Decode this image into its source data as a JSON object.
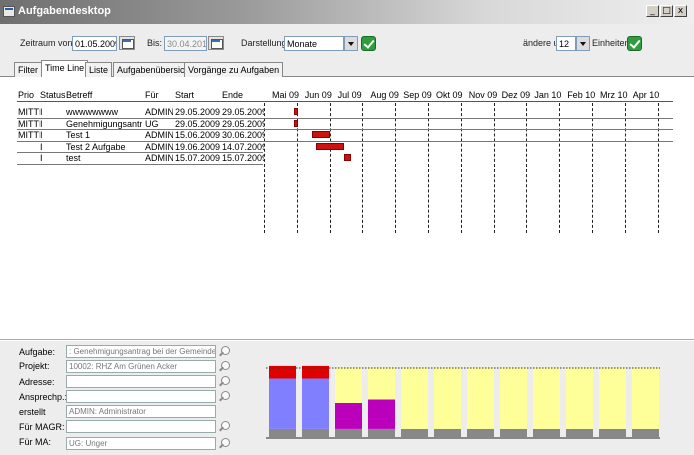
{
  "window": {
    "title": "Aufgabendesktop",
    "minimize": "_",
    "maximize": "□",
    "close": "x"
  },
  "toolbar": {
    "zeitraum_label": "Zeitraum von:",
    "von_value": "01.05.2009",
    "bis_label": "Bis:",
    "bis_value": "30.04.2010",
    "darstellung_label": "Darstellung",
    "darstellung_value": "Monate",
    "aendere_label": "ändere um",
    "aendere_value": "12",
    "einheiten_label": "Einheiten"
  },
  "tabs": [
    {
      "label": "Filter"
    },
    {
      "label": "Time Line"
    },
    {
      "label": "Liste"
    },
    {
      "label": "Aufgabenübersicht"
    },
    {
      "label": "Vorgänge zu Aufgaben"
    }
  ],
  "active_tab": "Time Line",
  "grid": {
    "columns": [
      "Prio",
      "Status",
      "Betreff",
      "Für",
      "Start",
      "Ende"
    ],
    "months": [
      "Mai 09",
      "Jun 09",
      "Jul 09",
      "Aug 09",
      "Sep 09",
      "Okt 09",
      "Nov 09",
      "Dez 09",
      "Jan 10",
      "Feb 10",
      "Mrz 10",
      "Apr 10"
    ],
    "rows": [
      {
        "prio": "MITTI",
        "status": "I",
        "betreff": "wwwwwwww",
        "fuer": "ADMIN",
        "start": "29.05.2009",
        "ende": "29.05.2009",
        "bar_start": 0.9,
        "bar_end": 1.0
      },
      {
        "prio": "MITTI",
        "status": "I",
        "betreff": "Genehmigungsantrs",
        "fuer": "UG",
        "start": "29.05.2009",
        "ende": "29.05.2009",
        "bar_start": 0.9,
        "bar_end": 1.0
      },
      {
        "prio": "MITTI",
        "status": "I",
        "betreff": "Test 1",
        "fuer": "ADMIN",
        "start": "15.06.2009",
        "ende": "30.06.2009",
        "bar_start": 1.45,
        "bar_end": 2.0
      },
      {
        "prio": "",
        "status": "I",
        "betreff": "Test 2 Aufgabe",
        "fuer": "ADMIN",
        "start": "19.06.2009",
        "ende": "14.07.2009",
        "bar_start": 1.6,
        "bar_end": 2.45
      },
      {
        "prio": "",
        "status": "I",
        "betreff": "test",
        "fuer": "ADMIN",
        "start": "15.07.2009",
        "ende": "15.07.2009",
        "bar_start": 2.45,
        "bar_end": 2.65
      }
    ]
  },
  "details": {
    "aufgabe_label": "Aufgabe:",
    "aufgabe_value": ": Genehmigungsantrag bei der Gemeinde",
    "projekt_label": "Projekt:",
    "projekt_value": "10002: RHZ Am Grünen Acker",
    "adresse_label": "Adresse:",
    "adresse_value": "",
    "ansprech_label": "Ansprechp.:",
    "ansprech_value": "",
    "erstellt_label": "erstellt",
    "erstellt_value": "ADMIN: Administrator",
    "magr_label": "Für MAGR:",
    "magr_value": "",
    "ma_label": "Für MA:",
    "ma_value": "UG: Unger"
  },
  "chart_data": {
    "type": "bar",
    "categories": [
      "Mai 09",
      "Jun 09",
      "Jul 09",
      "Aug 09",
      "Sep 09",
      "Okt 09",
      "Nov 09",
      "Dez 09",
      "Jan 10",
      "Feb 10",
      "Mrz 10",
      "Apr 10"
    ],
    "capacity": 1.0,
    "series": [
      {
        "values": [
          0.13,
          0.13,
          0.13,
          0.13,
          0.13,
          0.13,
          0.13,
          0.13,
          0.13,
          0.13,
          0.13,
          0.13
        ],
        "color": "#888888"
      },
      {
        "values": [
          0.72,
          0.72,
          0,
          0,
          0,
          0,
          0,
          0,
          0,
          0,
          0,
          0
        ],
        "color": "#8080ff"
      },
      {
        "values": [
          0,
          0,
          0.37,
          0.42,
          0,
          0,
          0,
          0,
          0,
          0,
          0,
          0
        ],
        "color": "#bb00bb"
      },
      {
        "values": [
          0,
          0,
          0.5,
          0.45,
          0.87,
          0.87,
          0.87,
          0.87,
          0.87,
          0.87,
          0.87,
          0.87
        ],
        "color": "#ffff99"
      },
      {
        "values": [
          0.18,
          0.18,
          0,
          0,
          0,
          0,
          0,
          0,
          0,
          0,
          0,
          0
        ],
        "color": "#e00000"
      }
    ]
  }
}
